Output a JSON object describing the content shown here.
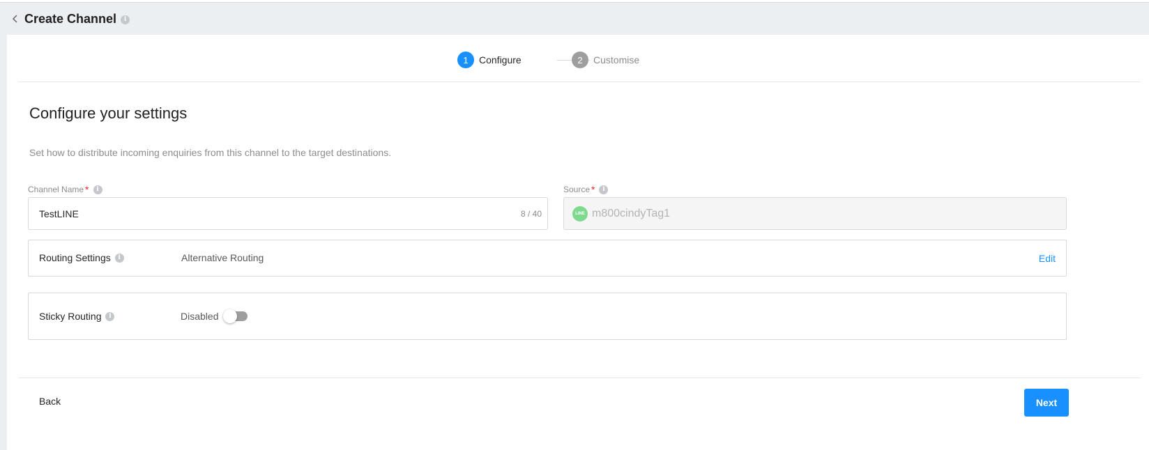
{
  "header": {
    "title": "Create Channel"
  },
  "stepper": {
    "steps": [
      {
        "number": "1",
        "label": "Configure",
        "state": "active"
      },
      {
        "number": "2",
        "label": "Customise",
        "state": "inactive"
      }
    ]
  },
  "main": {
    "title": "Configure your settings",
    "description": "Set how to distribute incoming enquiries from this channel to the target destinations."
  },
  "form": {
    "channel_name": {
      "label": "Channel Name",
      "required_mark": "*",
      "value": "TestLINE",
      "counter": "8 / 40"
    },
    "source": {
      "label": "Source",
      "required_mark": "*",
      "value": "m800cindyTag1",
      "logo_text": "LINE"
    },
    "routing_settings": {
      "label": "Routing Settings",
      "value": "Alternative Routing",
      "edit_label": "Edit"
    },
    "sticky_routing": {
      "label": "Sticky Routing",
      "status": "Disabled",
      "enabled": false
    }
  },
  "footer": {
    "back_label": "Back",
    "next_label": "Next"
  },
  "colors": {
    "accent": "#1890ff",
    "required": "#f5222d",
    "inactive_step": "#9e9e9e",
    "line_brand": "#7fd98f"
  }
}
